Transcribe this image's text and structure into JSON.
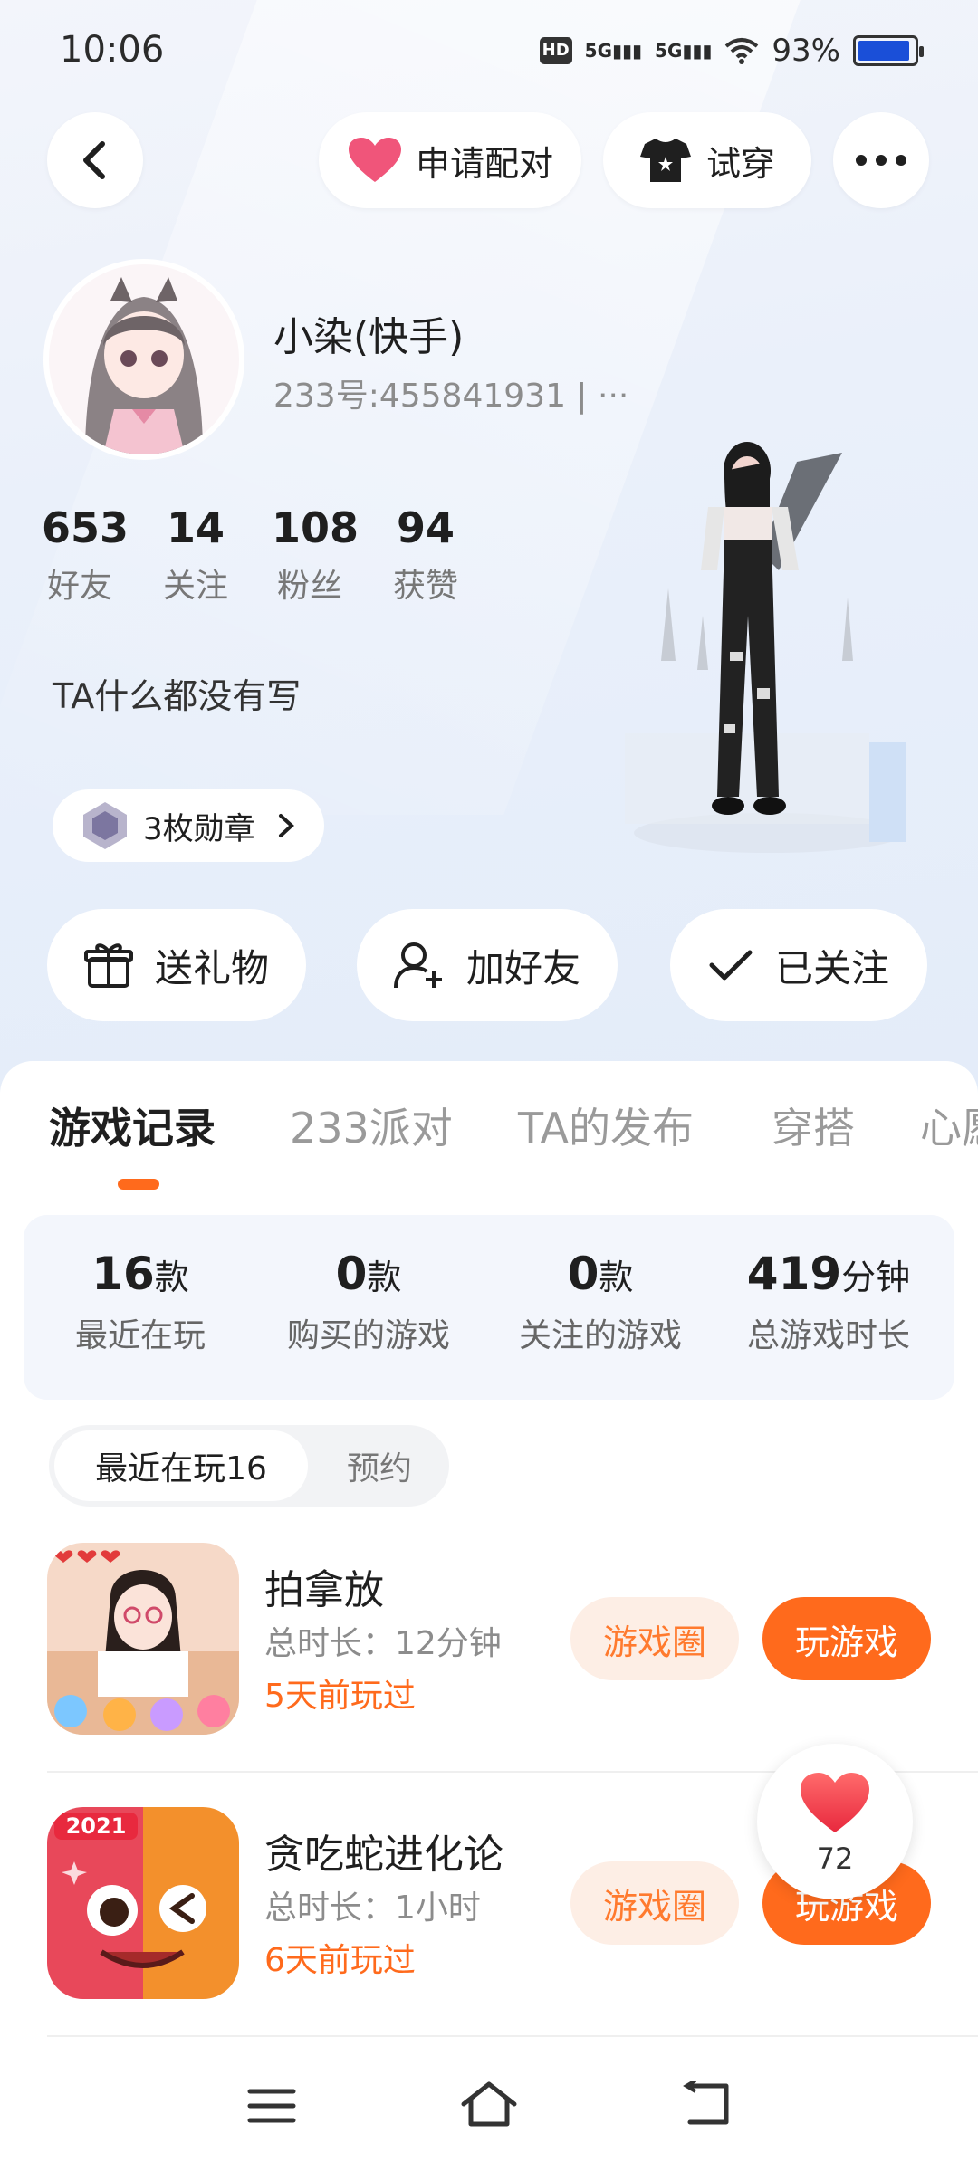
{
  "status_bar": {
    "time": "10:06",
    "battery": "93%",
    "signal1": "5G",
    "signal2": "5G"
  },
  "header": {
    "pair_label": "申请配对",
    "tryon_label": "试穿"
  },
  "profile": {
    "name": "小染(快手)",
    "uid": "233号:455841931 | ···",
    "stats": [
      {
        "value": "653",
        "label": "好友"
      },
      {
        "value": "14",
        "label": "关注"
      },
      {
        "value": "108",
        "label": "粉丝"
      },
      {
        "value": "94",
        "label": "获赞"
      }
    ],
    "bio": "TA什么都没有写",
    "badges_label": "3枚勋章"
  },
  "actions": {
    "gift": "送礼物",
    "add_friend": "加好友",
    "followed": "已关注"
  },
  "tabs": [
    "游戏记录",
    "233派对",
    "TA的发布",
    "穿搭",
    "心愿"
  ],
  "summary": [
    {
      "value": "16",
      "unit": "款",
      "label": "最近在玩"
    },
    {
      "value": "0",
      "unit": "款",
      "label": "购买的游戏"
    },
    {
      "value": "0",
      "unit": "款",
      "label": "关注的游戏"
    },
    {
      "value": "419",
      "unit": "分钟",
      "label": "总游戏时长"
    }
  ],
  "segment": {
    "recent": "最近在玩16",
    "reserve": "预约"
  },
  "games": [
    {
      "name": "拍拿放",
      "duration": "总时长：12分钟",
      "last_played": "5天前玩过",
      "circle_label": "游戏圈",
      "play_label": "玩游戏"
    },
    {
      "name": "贪吃蛇进化论",
      "duration": "总时长：1小时",
      "last_played": "6天前玩过",
      "circle_label": "游戏圈",
      "play_label": "玩游戏",
      "icon_year": "2021"
    }
  ],
  "like_count": "72",
  "colors": {
    "accent": "#ff6a1c",
    "accent_light": "#fdeee5",
    "pink": "#f0557a"
  }
}
